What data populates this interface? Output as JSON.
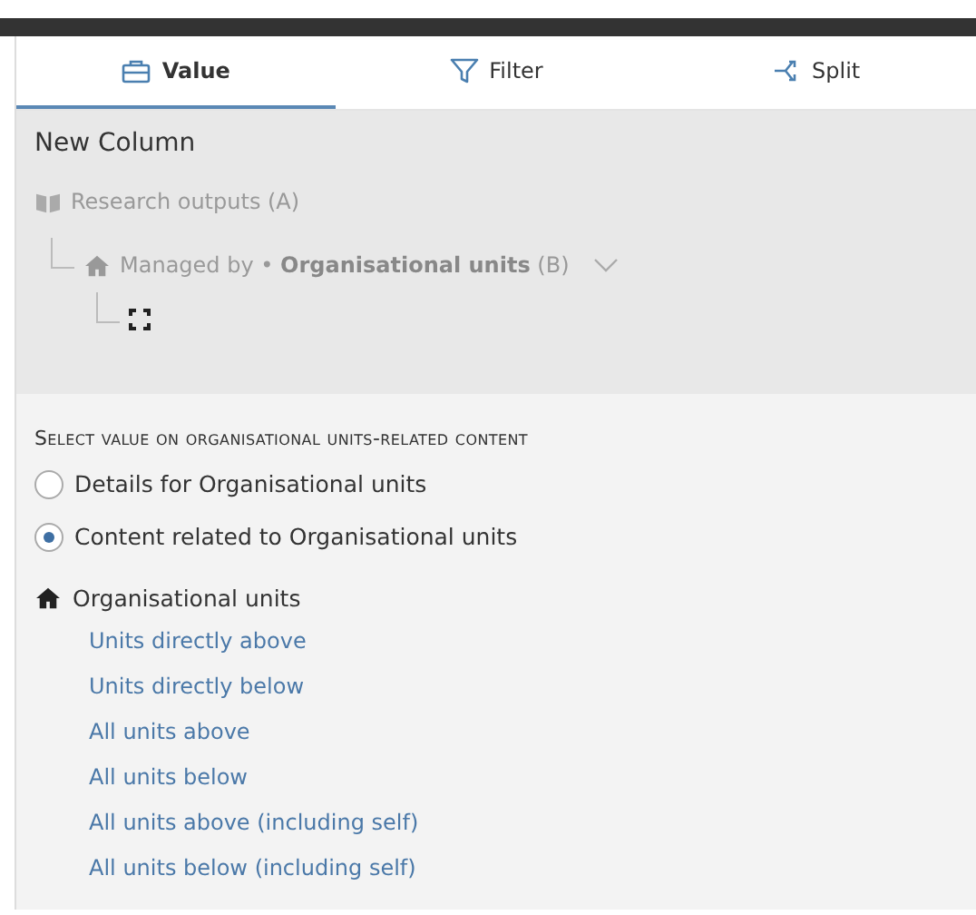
{
  "tabs": [
    {
      "label": "Value",
      "kind": "value",
      "selected": true
    },
    {
      "label": "Filter",
      "kind": "filter",
      "selected": false
    },
    {
      "label": "Split",
      "kind": "split",
      "selected": false
    }
  ],
  "column": {
    "title": "New Column",
    "source": "Research outputs (A)",
    "relation": "Managed by • **Organisational units** (B)"
  },
  "section": {
    "heading": "Select value on organisational units-related content",
    "options": [
      {
        "label": "Details for Organisational units",
        "selected": false
      },
      {
        "label": "Content related to Organisational units",
        "selected": true
      }
    ],
    "group": "Organisational units",
    "links": [
      "Units directly above",
      "Units directly below",
      "All units above",
      "All units below",
      "All units above (including self)",
      "All units below (including self)"
    ]
  }
}
